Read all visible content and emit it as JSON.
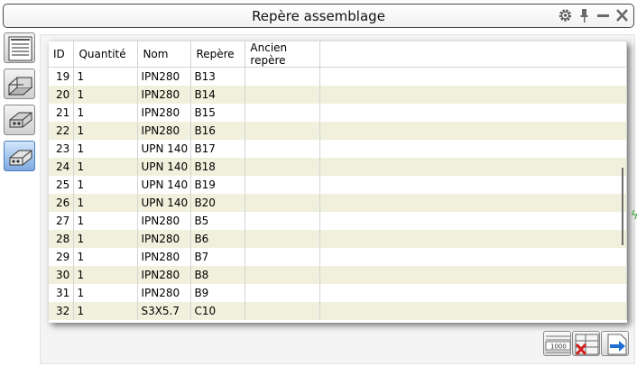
{
  "window": {
    "title": "Repère assemblage",
    "icons": [
      "settings-gear-icon",
      "pin-icon",
      "minimize-icon",
      "close-icon"
    ]
  },
  "toolbar_left": [
    {
      "name": "list-view-icon",
      "active": false
    },
    {
      "name": "beam-profile-icon",
      "active": false
    },
    {
      "name": "plate-profile-icon",
      "active": false
    },
    {
      "name": "assembly-profile-icon",
      "active": true
    }
  ],
  "table": {
    "columns": [
      "ID",
      "Quantité",
      "Nom",
      "Repère",
      "Ancien repère"
    ],
    "rows": [
      {
        "id": "19",
        "qty": "1",
        "nom": "IPN280",
        "repere": "B13",
        "ancien": ""
      },
      {
        "id": "20",
        "qty": "1",
        "nom": "IPN280",
        "repere": "B14",
        "ancien": ""
      },
      {
        "id": "21",
        "qty": "1",
        "nom": "IPN280",
        "repere": "B15",
        "ancien": ""
      },
      {
        "id": "22",
        "qty": "1",
        "nom": "IPN280",
        "repere": "B16",
        "ancien": ""
      },
      {
        "id": "23",
        "qty": "1",
        "nom": "UPN 140",
        "repere": "B17",
        "ancien": ""
      },
      {
        "id": "24",
        "qty": "1",
        "nom": "UPN 140",
        "repere": "B18",
        "ancien": ""
      },
      {
        "id": "25",
        "qty": "1",
        "nom": "UPN 140",
        "repere": "B19",
        "ancien": ""
      },
      {
        "id": "26",
        "qty": "1",
        "nom": "UPN 140",
        "repere": "B20",
        "ancien": ""
      },
      {
        "id": "27",
        "qty": "1",
        "nom": "IPN280",
        "repere": "B5",
        "ancien": ""
      },
      {
        "id": "28",
        "qty": "1",
        "nom": "IPN280",
        "repere": "B6",
        "ancien": ""
      },
      {
        "id": "29",
        "qty": "1",
        "nom": "IPN280",
        "repere": "B7",
        "ancien": ""
      },
      {
        "id": "30",
        "qty": "1",
        "nom": "IPN280",
        "repere": "B8",
        "ancien": ""
      },
      {
        "id": "31",
        "qty": "1",
        "nom": "IPN280",
        "repere": "B9",
        "ancien": ""
      },
      {
        "id": "32",
        "qty": "1",
        "nom": "S3X5.7",
        "repere": "C10",
        "ancien": ""
      }
    ]
  },
  "bottom_buttons": [
    {
      "name": "numbering-button",
      "label": "1000"
    },
    {
      "name": "delete-numbering-button"
    },
    {
      "name": "export-button"
    }
  ],
  "colors": {
    "alt_row": "#f0f0dc",
    "active_tool": "#7ea9e0",
    "accent_blue": "#1f6fd1",
    "delete_red": "#d42020"
  }
}
